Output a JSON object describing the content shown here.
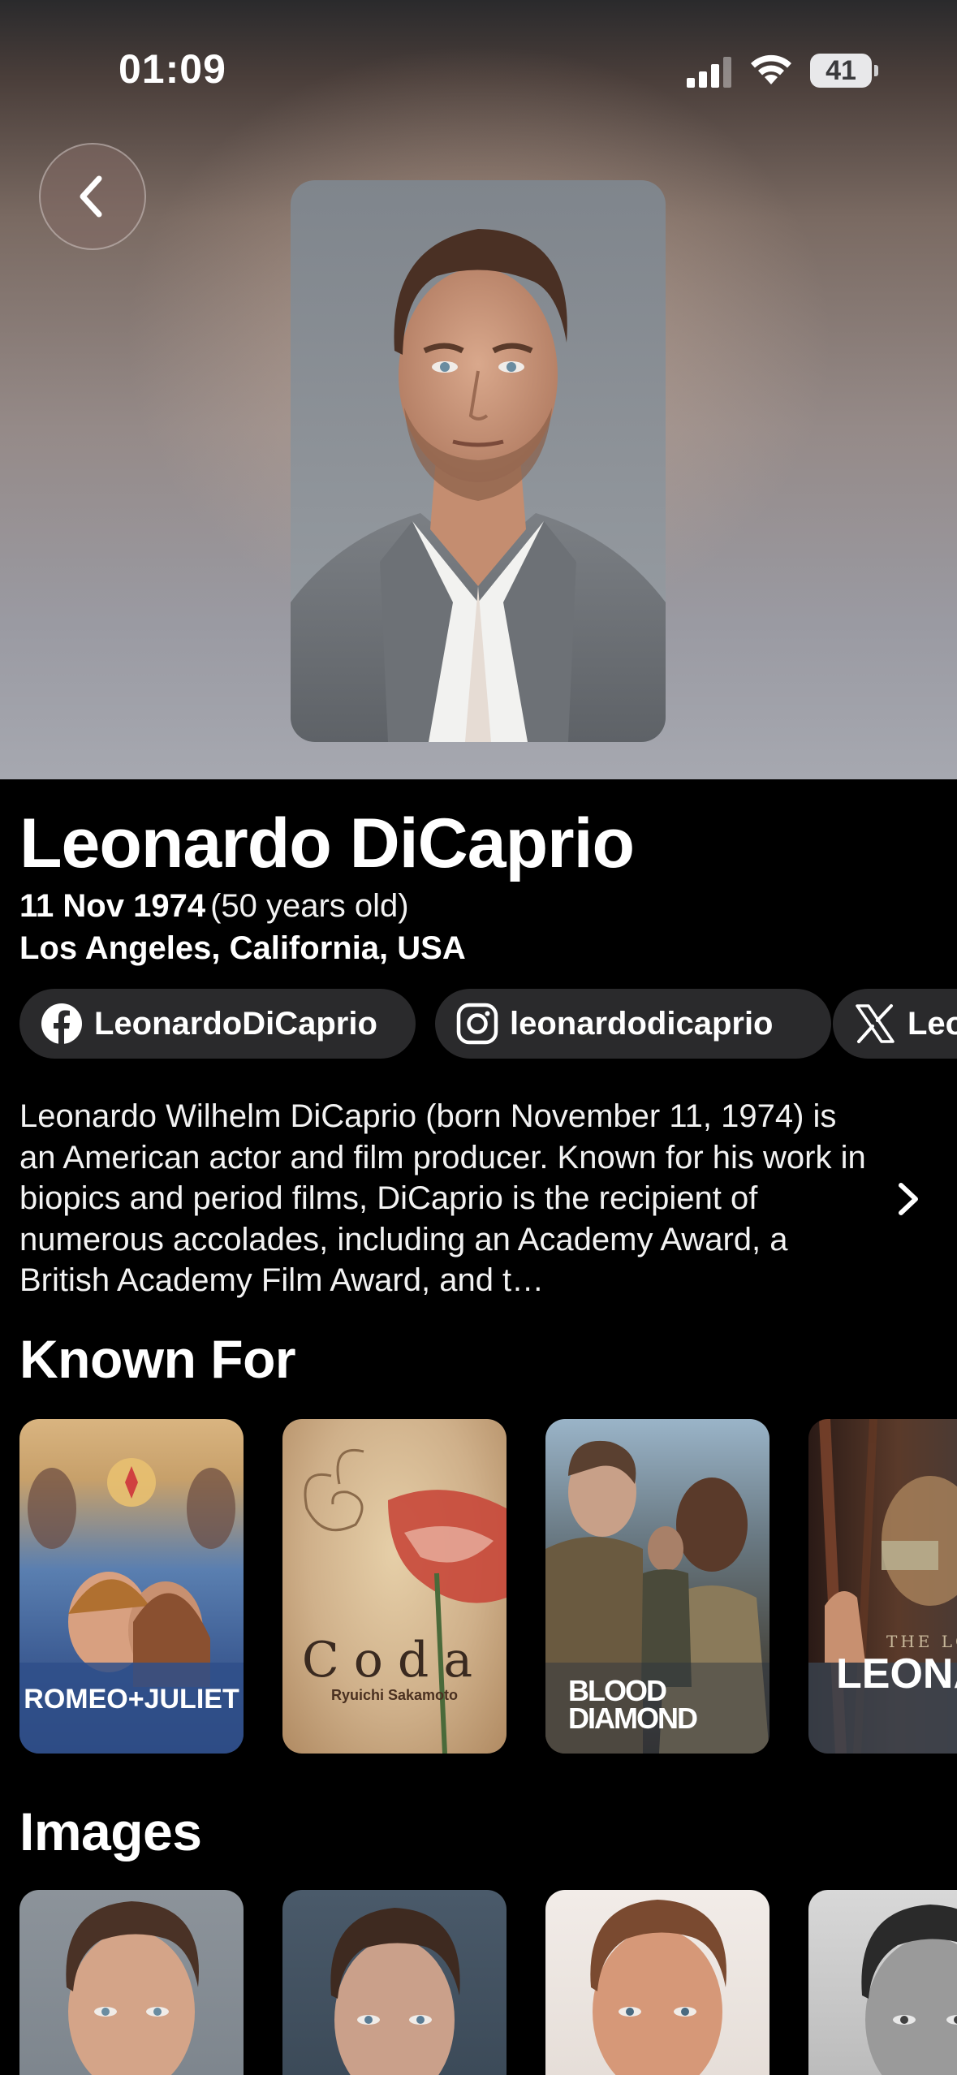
{
  "status_bar": {
    "time": "01:09",
    "battery": "41"
  },
  "person": {
    "name": "Leonardo DiCaprio",
    "birth_date": "11 Nov 1974",
    "age": "(50 years old)",
    "birthplace": "Los Angeles, California, USA",
    "socials": {
      "facebook": "LeonardoDiCaprio",
      "instagram": "leonardodicaprio",
      "x": "Leo"
    },
    "bio": "Leonardo Wilhelm DiCaprio (born November 11, 1974) is an American actor and film producer. Known for his work in biopics and period films, DiCaprio is the recipient of numerous accolades, including an Academy Award, a British Academy Film Award, and t…"
  },
  "sections": {
    "known_for": "Known For",
    "images": "Images"
  },
  "known_for": [
    {
      "title_text": "ROMEO+JULIET"
    },
    {
      "title_text": "Coda",
      "subtitle": "Ryuichi Sakamoto"
    },
    {
      "title_text": "BLOOD DIAMOND"
    },
    {
      "title_text": "LEONAR",
      "overline": "THE LOS"
    }
  ],
  "colors": {
    "background": "#000000",
    "chip_background": "#2a2a2c",
    "text": "#ffffff"
  }
}
